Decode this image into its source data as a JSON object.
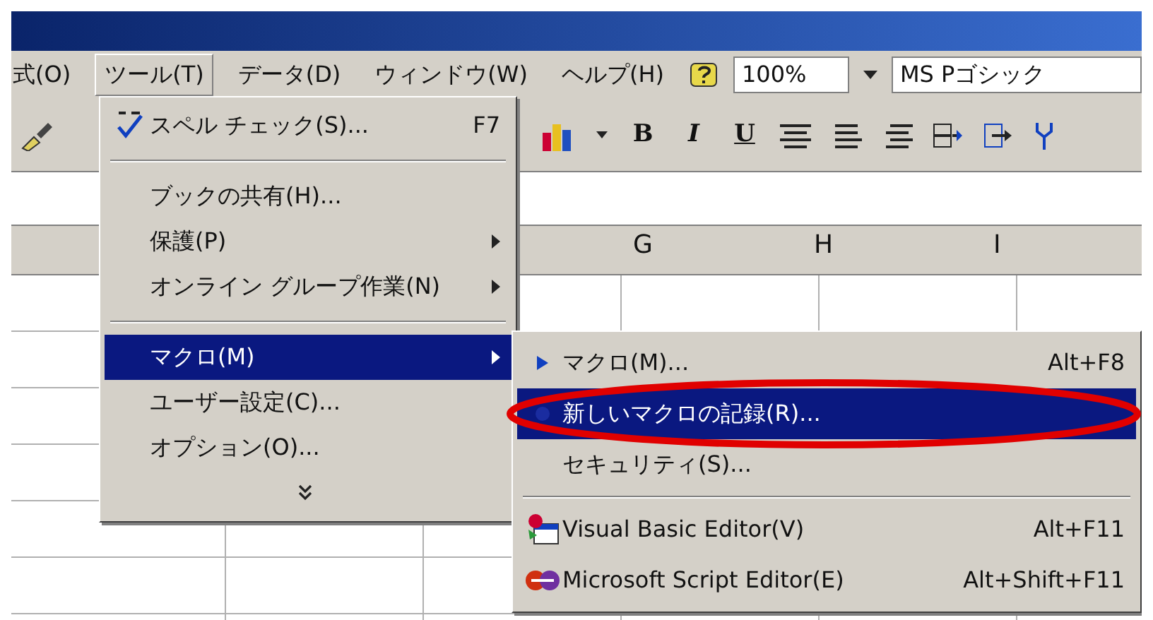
{
  "menubar": {
    "items": [
      {
        "label": "式(O)",
        "selected": false
      },
      {
        "label": "ツール(T)",
        "selected": true
      },
      {
        "label": "データ(D)",
        "selected": false
      },
      {
        "label": "ウィンドウ(W)",
        "selected": false
      },
      {
        "label": "ヘルプ(H)",
        "selected": false
      }
    ],
    "zoom": "100%",
    "font": "MS Pゴシック"
  },
  "toolbar": {
    "format_buttons": [
      "B",
      "I",
      "U"
    ]
  },
  "columns": [
    "G",
    "H",
    "I"
  ],
  "tools_menu": {
    "items": [
      {
        "kind": "item",
        "label": "スペル チェック(S)...",
        "shortcut": "F7",
        "submenu": false,
        "selected": false
      },
      {
        "kind": "separator"
      },
      {
        "kind": "item",
        "label": "ブックの共有(H)...",
        "submenu": false,
        "selected": false
      },
      {
        "kind": "item",
        "label": "保護(P)",
        "submenu": true,
        "selected": false
      },
      {
        "kind": "item",
        "label": "オンライン グループ作業(N)",
        "submenu": true,
        "selected": false
      },
      {
        "kind": "separator"
      },
      {
        "kind": "item",
        "label": "マクロ(M)",
        "submenu": true,
        "selected": true
      },
      {
        "kind": "item",
        "label": "ユーザー設定(C)...",
        "submenu": false,
        "selected": false
      },
      {
        "kind": "item",
        "label": "オプション(O)...",
        "submenu": false,
        "selected": false
      },
      {
        "kind": "expand"
      }
    ]
  },
  "macro_menu": {
    "items": [
      {
        "kind": "item",
        "label": "マクロ(M)...",
        "shortcut": "Alt+F8",
        "submenu": false,
        "selected": false
      },
      {
        "kind": "item",
        "label": "新しいマクロの記録(R)...",
        "submenu": false,
        "selected": true
      },
      {
        "kind": "item",
        "label": "セキュリティ(S)...",
        "submenu": false,
        "selected": false
      },
      {
        "kind": "separator"
      },
      {
        "kind": "item",
        "label": "Visual Basic Editor(V)",
        "shortcut": "Alt+F11",
        "submenu": false,
        "selected": false
      },
      {
        "kind": "item",
        "label": "Microsoft Script Editor(E)",
        "shortcut": "Alt+Shift+F11",
        "submenu": false,
        "selected": false
      }
    ]
  }
}
